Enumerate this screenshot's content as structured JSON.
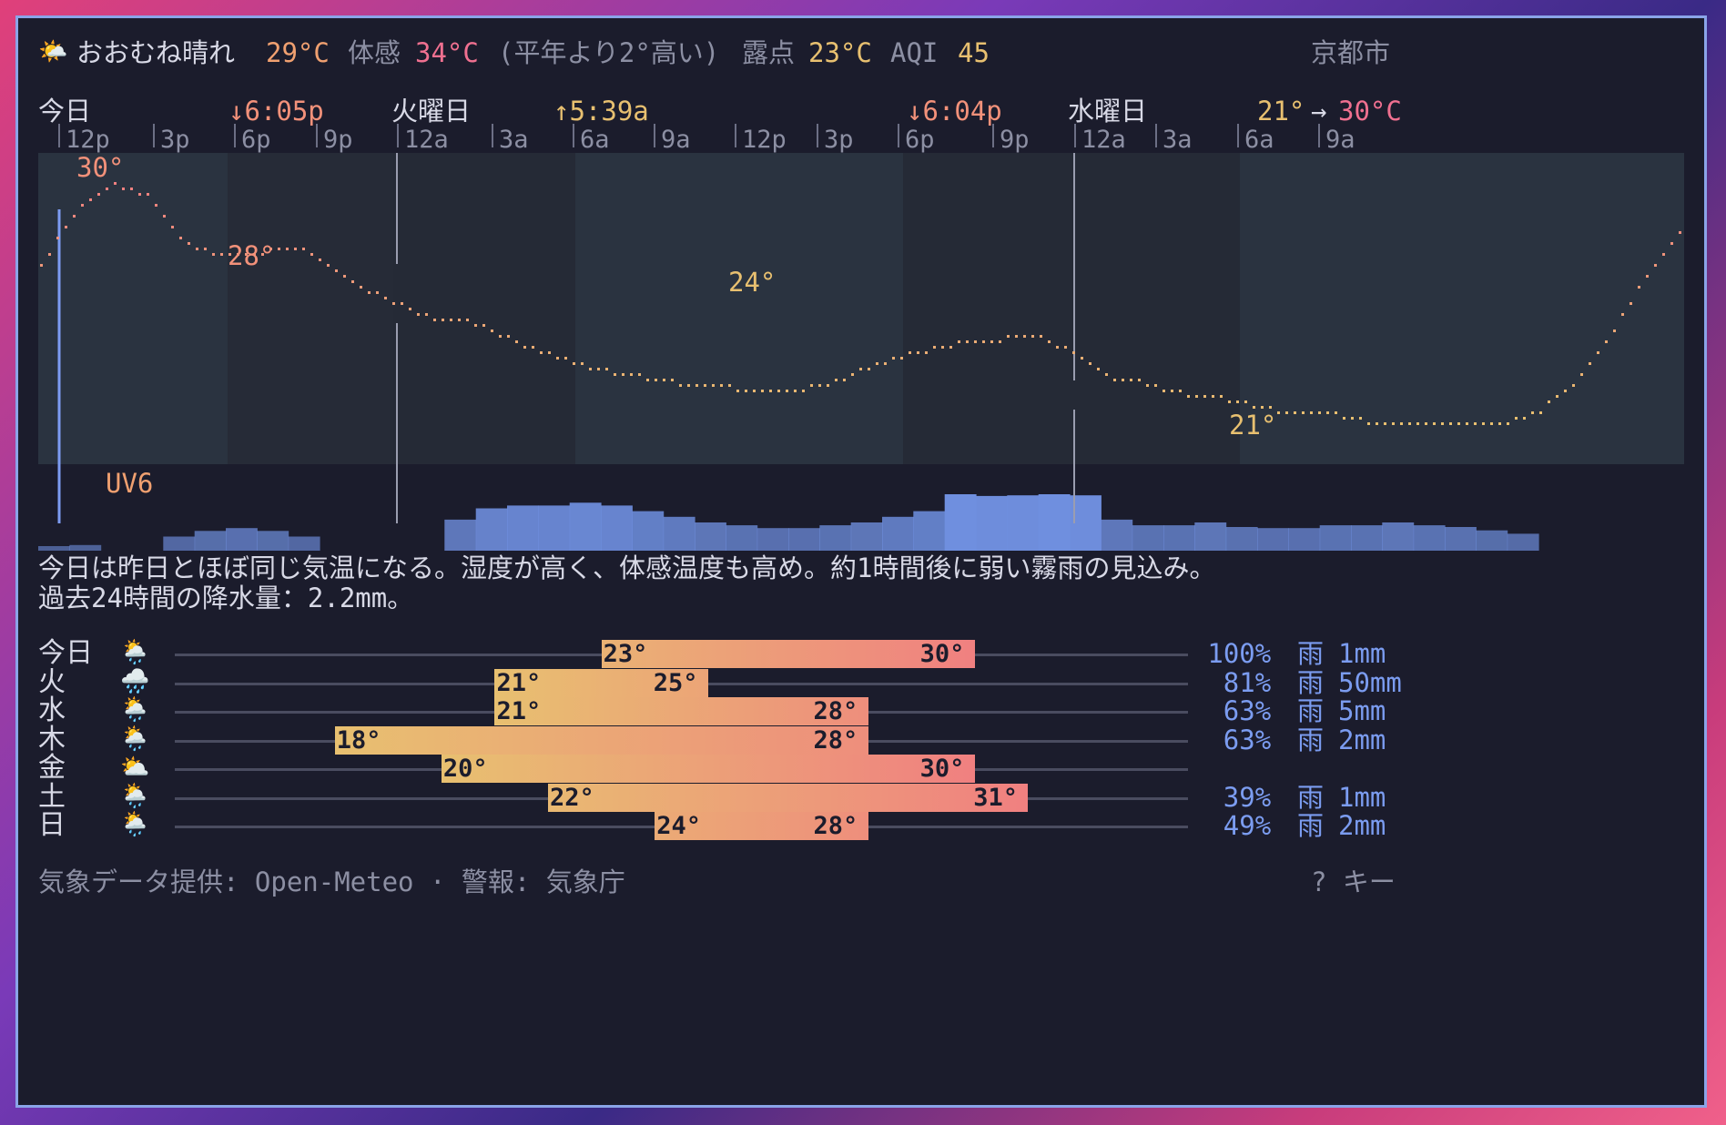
{
  "header": {
    "icon": "sun-behind-cloud-icon",
    "condition": "おおむね晴れ",
    "temp": "29°C",
    "feels_label": "体感",
    "feels_value": "34°C",
    "compare": "(平年より2°高い)",
    "dewpoint_label": "露点",
    "dewpoint_value": "23°C",
    "aqi_label": "AQI",
    "aqi_value": "45",
    "location": "京都市"
  },
  "timeline": {
    "day_today": "今日",
    "sunset1": "↓6:05p",
    "day_tue": "火曜日",
    "sunrise": "↑5:39a",
    "sunset2": "↓6:04p",
    "day_wed": "水曜日",
    "range_low": "21°",
    "range_arrow": "→",
    "range_high": "30°C",
    "ticks": [
      "12p",
      "3p",
      "6p",
      "9p",
      "12a",
      "3a",
      "6a",
      "9a",
      "12p",
      "3p",
      "6p",
      "9p",
      "12a",
      "3a",
      "6a",
      "9a"
    ]
  },
  "chart_data": {
    "type": "line",
    "x_unit": "hour",
    "series": [
      {
        "values": [
          26.8,
          29.0,
          30.0,
          29.5,
          27.8,
          27.2,
          27.3,
          27.6,
          27.0,
          26.0,
          25.4,
          24.9,
          24.7,
          24.2,
          23.6,
          23.2,
          22.8,
          22.6,
          22.4,
          22.3,
          22.1,
          22.1,
          22.4,
          22.9,
          23.4,
          23.7,
          24.0,
          24.1,
          24.1,
          23.6,
          22.6,
          22.4,
          22.0,
          21.9,
          21.6,
          21.3,
          21.3,
          21.0,
          20.9,
          20.9,
          20.9,
          20.9,
          21.4,
          22.5,
          24.3,
          26.5,
          28.4
        ]
      }
    ],
    "peak_labels": [
      "30°",
      "28°",
      "24°",
      "21°"
    ],
    "uv_label": "UV6",
    "precip_profile": [
      0.08,
      0.1,
      0,
      0,
      0.25,
      0.35,
      0.4,
      0.35,
      0.25,
      0,
      0,
      0,
      0,
      0.55,
      0.75,
      0.8,
      0.8,
      0.85,
      0.8,
      0.7,
      0.6,
      0.5,
      0.45,
      0.4,
      0.4,
      0.45,
      0.5,
      0.6,
      0.7,
      1.0,
      0.97,
      0.98,
      1.0,
      0.98,
      0.55,
      0.45,
      0.45,
      0.5,
      0.42,
      0.4,
      0.4,
      0.45,
      0.45,
      0.5,
      0.45,
      0.42,
      0.36,
      0.3
    ]
  },
  "summary": {
    "line1": "今日は昨日とほぼ同じ気温になる。湿度が高く、体感温度も高め。約1時間後に弱い霧雨の見込み。",
    "line2": "過去24時間の降水量：2.2mm。"
  },
  "forecast": [
    {
      "day": "今日",
      "icon": "sun-rain-cloud-icon",
      "emoji": "🌦️",
      "low": 23,
      "high": 30,
      "low_label": "23°",
      "high_label": "30°",
      "pop": "100%",
      "kind": "雨",
      "amount": "1mm"
    },
    {
      "day": "火",
      "icon": "rain-cloud-icon",
      "emoji": "🌧️",
      "low": 21,
      "high": 25,
      "low_label": "21°",
      "high_label": "25°",
      "pop": "81%",
      "kind": "雨",
      "amount": "50mm"
    },
    {
      "day": "水",
      "icon": "sun-rain-cloud-icon",
      "emoji": "🌦️",
      "low": 21,
      "high": 28,
      "low_label": "21°",
      "high_label": "28°",
      "pop": "63%",
      "kind": "雨",
      "amount": "5mm"
    },
    {
      "day": "木",
      "icon": "sun-rain-cloud-icon",
      "emoji": "🌦️",
      "low": 18,
      "high": 28,
      "low_label": "18°",
      "high_label": "28°",
      "pop": "63%",
      "kind": "雨",
      "amount": "2mm"
    },
    {
      "day": "金",
      "icon": "sun-behind-cloud-icon",
      "emoji": "⛅",
      "low": 20,
      "high": 30,
      "low_label": "20°",
      "high_label": "30°",
      "pop": "",
      "kind": "",
      "amount": ""
    },
    {
      "day": "土",
      "icon": "sun-rain-cloud-icon",
      "emoji": "🌦️",
      "low": 22,
      "high": 31,
      "low_label": "22°",
      "high_label": "31°",
      "pop": "39%",
      "kind": "雨",
      "amount": "1mm"
    },
    {
      "day": "日",
      "icon": "sun-rain-cloud-icon",
      "emoji": "🌦️",
      "low": 24,
      "high": 28,
      "low_label": "24°",
      "high_label": "28°",
      "pop": "49%",
      "kind": "雨",
      "amount": "2mm"
    }
  ],
  "forecast_scale": {
    "min": 15,
    "max": 34
  },
  "footer": {
    "credit": "気象データ提供: Open-Meteo · 警報: 気象庁",
    "help": "? キー"
  }
}
